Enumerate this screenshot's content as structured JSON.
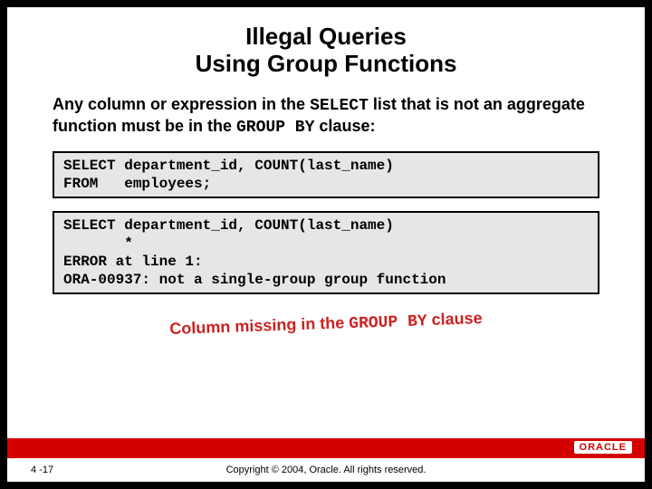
{
  "title_line1": "Illegal Queries",
  "title_line2": "Using Group Functions",
  "intro_pre": "Any column or expression in the ",
  "intro_kw1": "SELECT",
  "intro_mid": " list that is not an aggregate function must be in the ",
  "intro_kw2": "GROUP BY",
  "intro_post": " clause:",
  "code1": "SELECT department_id, COUNT(last_name)\nFROM   employees;",
  "code2": "SELECT department_id, COUNT(last_name)\n       *\nERROR at line 1:\nORA-00937: not a single-group group function",
  "annotation_pre": "Column missing in the ",
  "annotation_kw": "GROUP BY",
  "annotation_post": " clause",
  "logo": "ORACLE",
  "pagenum": "4 -17",
  "copyright": "Copyright © 2004, Oracle.  All rights reserved."
}
